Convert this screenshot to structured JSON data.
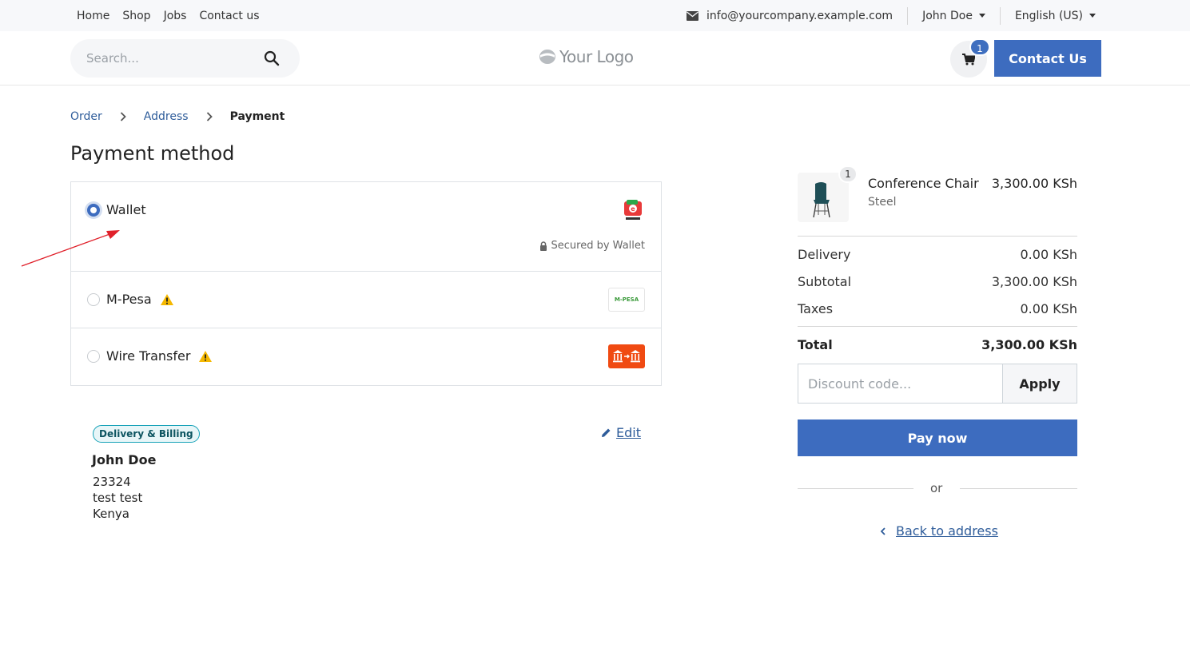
{
  "topnav": {
    "items": [
      "Home",
      "Shop",
      "Jobs",
      "Contact us"
    ],
    "email": "info@yourcompany.example.com",
    "user": "John Doe",
    "language": "English (US)"
  },
  "header": {
    "search_placeholder": "Search...",
    "logo_text": "Your Logo",
    "cart_count": "1",
    "contact_button": "Contact Us"
  },
  "breadcrumb": {
    "items": [
      "Order",
      "Address",
      "Payment"
    ]
  },
  "page_title": "Payment method",
  "payment": {
    "options": [
      {
        "label": "Wallet",
        "selected": true,
        "warning": false
      },
      {
        "label": "M-Pesa",
        "selected": false,
        "warning": true
      },
      {
        "label": "Wire Transfer",
        "selected": false,
        "warning": true
      }
    ],
    "secured_text": "Secured by Wallet",
    "mpesa_logo_text": "M-PESA"
  },
  "address": {
    "badge": "Delivery & Billing",
    "edit_label": "Edit",
    "name": "John Doe",
    "lines": [
      "23324",
      "test test",
      "Kenya"
    ]
  },
  "summary": {
    "product": {
      "qty": "1",
      "name": "Conference Chair",
      "variant": "Steel",
      "price": "3,300.00 KSh"
    },
    "delivery_label": "Delivery",
    "delivery_value": "0.00 KSh",
    "subtotal_label": "Subtotal",
    "subtotal_value": "3,300.00 KSh",
    "taxes_label": "Taxes",
    "taxes_value": "0.00 KSh",
    "total_label": "Total",
    "total_value": "3,300.00 KSh",
    "discount_placeholder": "Discount code...",
    "apply_label": "Apply",
    "pay_label": "Pay now",
    "or_label": "or",
    "back_label": "Back to address"
  },
  "colors": {
    "primary": "#3d6cbf",
    "link": "#2e5c9a",
    "warning": "#f5b800",
    "annotation_arrow": "#e0202a"
  }
}
